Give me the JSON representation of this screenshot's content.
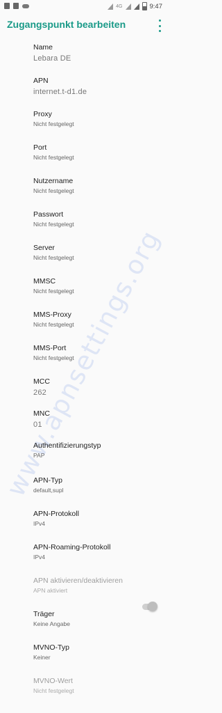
{
  "status_bar": {
    "left_icons": [
      "sd-card-icon",
      "data-saver-icon",
      "cloud-icon"
    ],
    "network_label": "4G",
    "time": "9:47"
  },
  "toolbar": {
    "title": "Zugangspunkt bearbeiten",
    "menu_icon": "more-vert-icon"
  },
  "settings": [
    {
      "label": "Name",
      "value": "Lebara DE"
    },
    {
      "label": "APN",
      "value": "internet.t-d1.de"
    },
    {
      "label": "Proxy",
      "value": "Nicht festgelegt"
    },
    {
      "label": "Port",
      "value": "Nicht festgelegt"
    },
    {
      "label": "Nutzername",
      "value": "Nicht festgelegt"
    },
    {
      "label": "Passwort",
      "value": "Nicht festgelegt"
    },
    {
      "label": "Server",
      "value": "Nicht festgelegt"
    },
    {
      "label": "MMSC",
      "value": "Nicht festgelegt"
    },
    {
      "label": "MMS-Proxy",
      "value": "Nicht festgelegt"
    },
    {
      "label": "MMS-Port",
      "value": "Nicht festgelegt"
    },
    {
      "label": "MCC",
      "value": "262"
    },
    {
      "label": "MNC",
      "value": "01"
    },
    {
      "label": "Authentifizierungstyp",
      "value": "PAP"
    },
    {
      "label": "APN-Typ",
      "value": "default,supl"
    },
    {
      "label": "APN-Protokoll",
      "value": "IPv4"
    },
    {
      "label": "APN-Roaming-Protokoll",
      "value": "IPv4"
    },
    {
      "label": "APN aktivieren/deaktivieren",
      "value": "APN aktiviert",
      "enabled": true
    },
    {
      "label": "Träger",
      "value": "Keine Angabe"
    },
    {
      "label": "MVNO-Typ",
      "value": "Keiner"
    },
    {
      "label": "MVNO-Wert",
      "value": "Nicht festgelegt"
    }
  ],
  "watermark": "www.apnsettings.org"
}
